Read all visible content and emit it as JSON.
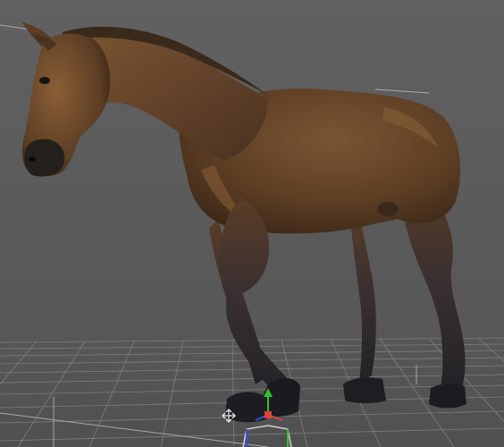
{
  "viewport": {
    "name": "3D viewport",
    "background": "#5b5b5b",
    "ground_grid": "#8a8a8a",
    "ground_color": "#4f4f4f"
  },
  "scene": {
    "object": "horse-model",
    "coat_color": "#6b4a2c",
    "coat_highlight": "#9a6a3a",
    "leg_color": "#2a2a2e",
    "mane_color": "#3a2a1c"
  },
  "gizmo": {
    "x_axis_color": "#e04040",
    "y_axis_color": "#30c030",
    "z_axis_color": "#3050e0",
    "handle_color": "#d0d0d0"
  },
  "icons": {
    "move-icon": "four-way-arrow-cursor"
  }
}
